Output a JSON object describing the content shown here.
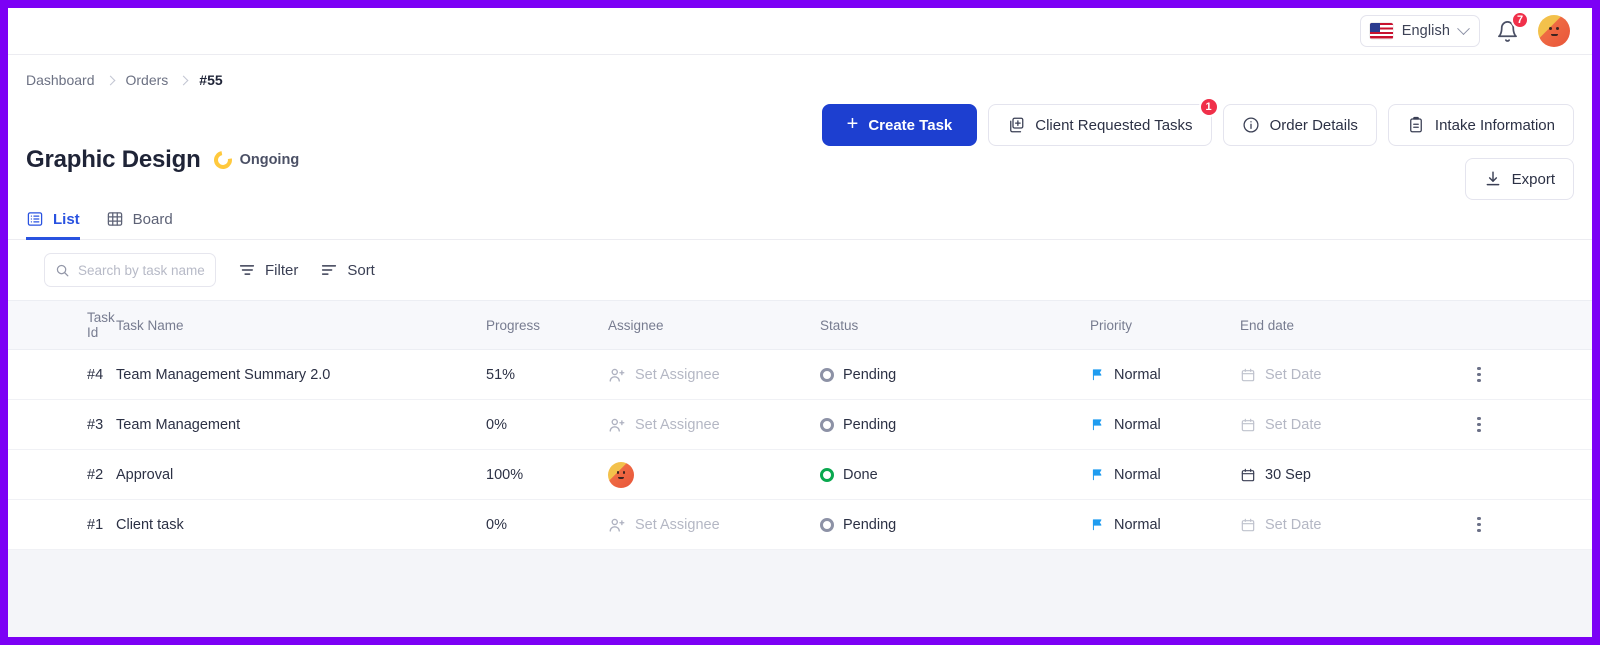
{
  "topbar": {
    "language": "English",
    "flag_icon": "us-flag-icon",
    "chevron_icon": "chevron-down-icon",
    "bell_icon": "bell-icon",
    "notification_count": "7",
    "avatar_icon": "user-avatar"
  },
  "breadcrumb": {
    "items": [
      {
        "label": "Dashboard",
        "current": false
      },
      {
        "label": "Orders",
        "current": false
      },
      {
        "label": "#55",
        "current": true
      }
    ]
  },
  "header": {
    "title": "Graphic Design",
    "status": "Ongoing",
    "status_icon": "ongoing-donut-icon",
    "status_color": "#ffc93d"
  },
  "actions": {
    "create_task": {
      "label": "Create Task",
      "icon": "plus-icon",
      "color": "#1d3fd0"
    },
    "client_requested_tasks": {
      "label": "Client Requested Tasks",
      "icon": "copy-plus-icon",
      "badge": "1",
      "badge_color": "#f0304a"
    },
    "order_details": {
      "label": "Order Details",
      "icon": "info-circle-icon"
    },
    "intake_information": {
      "label": "Intake Information",
      "icon": "clipboard-icon"
    },
    "export": {
      "label": "Export",
      "icon": "download-icon"
    }
  },
  "tabs": [
    {
      "label": "List",
      "icon": "list-view-icon",
      "active": true
    },
    {
      "label": "Board",
      "icon": "grid-view-icon",
      "active": false
    }
  ],
  "toolbar": {
    "search": {
      "value": "",
      "placeholder": "Search by task name",
      "icon": "search-icon"
    },
    "filter": {
      "label": "Filter",
      "icon": "filter-icon"
    },
    "sort": {
      "label": "Sort",
      "icon": "sort-icon"
    }
  },
  "table": {
    "columns": [
      "Task Id",
      "Task Name",
      "Progress",
      "Assignee",
      "Status",
      "Priority",
      "End date"
    ],
    "rows": [
      {
        "task_id": "#4",
        "task_name": "Team Management Summary 2.0",
        "progress": "51%",
        "assignee": "Set Assignee",
        "assignee_set": false,
        "status": "Pending",
        "status_state": "pending",
        "priority": "Normal",
        "end_date": "Set Date",
        "date_set": false,
        "has_menu": true
      },
      {
        "task_id": "#3",
        "task_name": "Team Management",
        "progress": "0%",
        "assignee": "Set Assignee",
        "assignee_set": false,
        "status": "Pending",
        "status_state": "pending",
        "priority": "Normal",
        "end_date": "Set Date",
        "date_set": false,
        "has_menu": true
      },
      {
        "task_id": "#2",
        "task_name": "Approval",
        "progress": "100%",
        "assignee": "",
        "assignee_set": true,
        "status": "Done",
        "status_state": "done",
        "priority": "Normal",
        "end_date": "30 Sep",
        "date_set": true,
        "has_menu": false
      },
      {
        "task_id": "#1",
        "task_name": "Client task",
        "progress": "0%",
        "assignee": "Set Assignee",
        "assignee_set": false,
        "status": "Pending",
        "status_state": "pending",
        "priority": "Normal",
        "end_date": "Set Date",
        "date_set": false,
        "has_menu": true
      }
    ],
    "icons": {
      "assignee": "person-add-icon",
      "calendar": "calendar-icon",
      "flag": "flag-icon",
      "menu": "kebab-menu-icon"
    },
    "flag_color": "#1f9cf0",
    "done_color": "#0aa84f",
    "pending_color": "#8d92a6"
  }
}
